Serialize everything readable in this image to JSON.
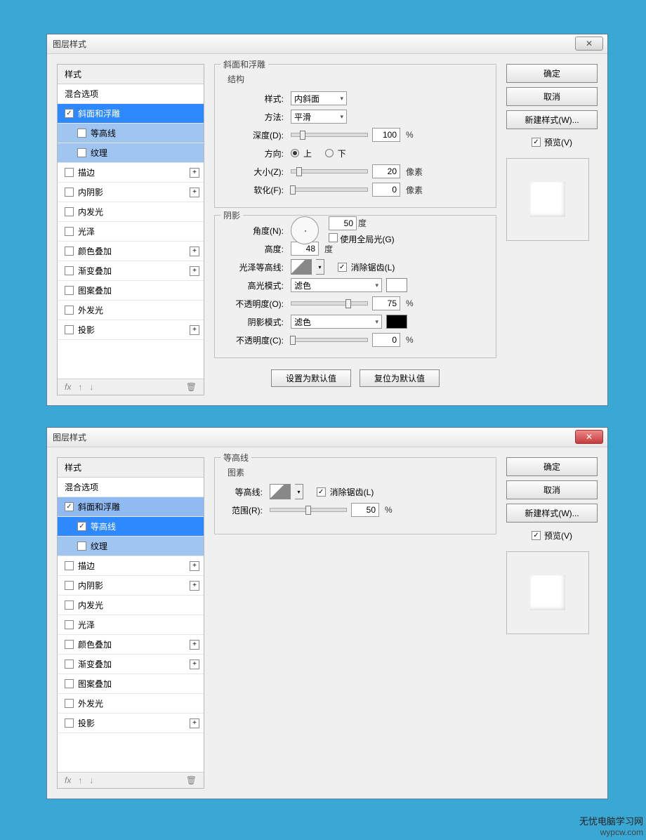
{
  "dialog_title": "图层样式",
  "close_glyph": "✕",
  "stylelist": {
    "header": "样式",
    "blendopts": "混合选项",
    "items": [
      {
        "label": "斜面和浮雕",
        "checked": true,
        "plus": false
      },
      {
        "label": "等高线",
        "checked": false,
        "plus": false,
        "indent": true
      },
      {
        "label": "纹理",
        "checked": false,
        "plus": false,
        "indent": true
      },
      {
        "label": "描边",
        "checked": false,
        "plus": true
      },
      {
        "label": "内阴影",
        "checked": false,
        "plus": true
      },
      {
        "label": "内发光",
        "checked": false,
        "plus": false
      },
      {
        "label": "光泽",
        "checked": false,
        "plus": false
      },
      {
        "label": "颜色叠加",
        "checked": false,
        "plus": true
      },
      {
        "label": "渐变叠加",
        "checked": false,
        "plus": true
      },
      {
        "label": "图案叠加",
        "checked": false,
        "plus": false
      },
      {
        "label": "外发光",
        "checked": false,
        "plus": false
      },
      {
        "label": "投影",
        "checked": false,
        "plus": true
      }
    ],
    "items2": [
      {
        "label": "斜面和浮雕",
        "checked": true
      },
      {
        "label": "等高线",
        "checked": true,
        "indent": true
      },
      {
        "label": "纹理",
        "checked": false,
        "indent": true
      },
      {
        "label": "描边",
        "checked": false,
        "plus": true
      },
      {
        "label": "内阴影",
        "checked": false,
        "plus": true
      },
      {
        "label": "内发光",
        "checked": false
      },
      {
        "label": "光泽",
        "checked": false
      },
      {
        "label": "颜色叠加",
        "checked": false,
        "plus": true
      },
      {
        "label": "渐变叠加",
        "checked": false,
        "plus": true
      },
      {
        "label": "图案叠加",
        "checked": false
      },
      {
        "label": "外发光",
        "checked": false
      },
      {
        "label": "投影",
        "checked": false,
        "plus": true
      }
    ],
    "fx": "fx",
    "trash": "🗑"
  },
  "bevel": {
    "group_title": "斜面和浮雕",
    "struct_title": "结构",
    "style_label": "样式:",
    "style_val": "内斜面",
    "tech_label": "方法:",
    "tech_val": "平滑",
    "depth_label": "深度(D):",
    "depth_val": "100",
    "percent": "%",
    "dir_label": "方向:",
    "dir_up": "上",
    "dir_down": "下",
    "size_label": "大小(Z):",
    "size_val": "20",
    "px": "像素",
    "soften_label": "软化(F):",
    "soften_val": "0",
    "shade_title": "阴影",
    "angle_label": "角度(N):",
    "angle_val": "50",
    "deg": "度",
    "global_label": "使用全局光(G)",
    "alt_label": "高度:",
    "alt_val": "48",
    "gloss_label": "光泽等高线:",
    "aa_label": "消除锯齿(L)",
    "hl_mode_label": "高光模式:",
    "hl_mode_val": "滤色",
    "hl_op_label": "不透明度(O):",
    "hl_op_val": "75",
    "sh_mode_label": "阴影模式:",
    "sh_mode_val": "滤色",
    "sh_op_label": "不透明度(C):",
    "sh_op_val": "0",
    "reset": "设置为默认值",
    "default": "复位为默认值"
  },
  "contour": {
    "group_title": "等高线",
    "elem_title": "图素",
    "contour_label": "等高线:",
    "aa_label": "消除锯齿(L)",
    "range_label": "范围(R):",
    "range_val": "50",
    "percent": "%"
  },
  "buttons": {
    "ok": "确定",
    "cancel": "取消",
    "newstyle": "新建样式(W)...",
    "preview": "预览(V)"
  },
  "watermark": {
    "cn": "无忧电脑学习网",
    "en": "wypcw.com"
  }
}
